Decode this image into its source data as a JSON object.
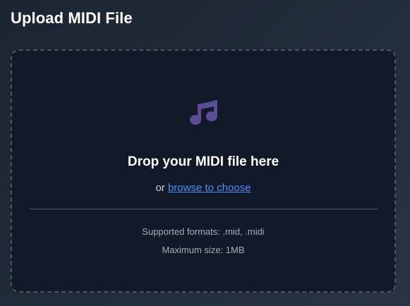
{
  "header": {
    "title": "Upload MIDI File"
  },
  "dropzone": {
    "icon": "music-note-icon",
    "icon_color": "#5b4d94",
    "title": "Drop your MIDI file here",
    "browse_prefix": "or",
    "browse_link": "browse to choose",
    "formats_text": "Supported formats: .mid, .midi",
    "max_size_text": "Maximum size: 1MB"
  },
  "colors": {
    "background": "#222d3b",
    "dropzone_bg": "#121a29",
    "dashed_border": "#4b5563",
    "link": "#4c8dff"
  }
}
